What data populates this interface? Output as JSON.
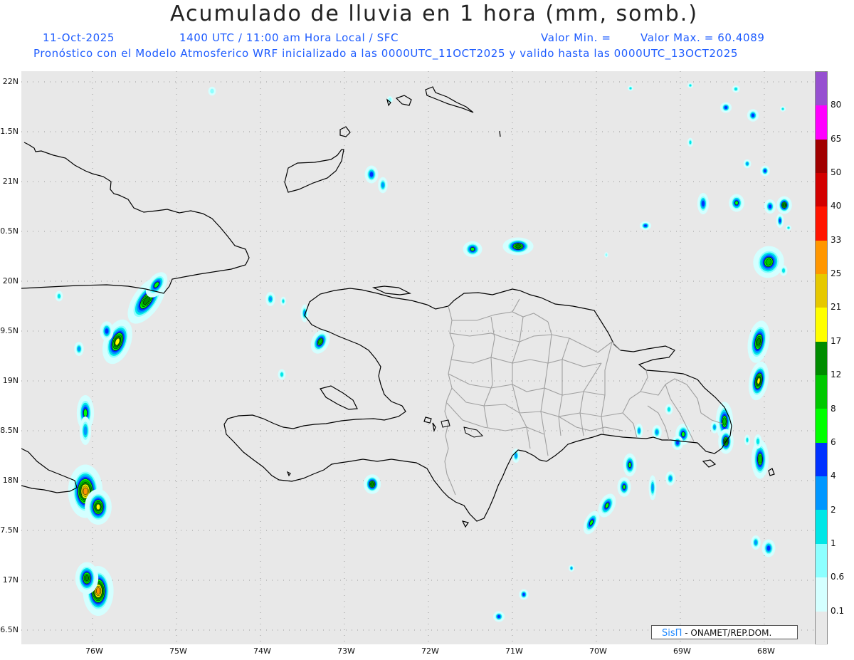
{
  "header": {
    "title": "Acumulado de lluvia en 1 hora (mm, somb.)",
    "date": "11-Oct-2025",
    "time_line": "1400 UTC / 11:00 am Hora Local / SFC",
    "valor_min": "Valor Min. =",
    "valor_max": "Valor Max. = 60.4089",
    "description": "Pronóstico con el Modelo Atmosferico WRF inicializado a las 0000UTC_11OCT2025 y valido hasta las  0000UTC_13OCT2025"
  },
  "axes": {
    "lat_labels": [
      "22N",
      "1.5N",
      "21N",
      "0.5N",
      "20N",
      "9.5N",
      "19N",
      "8.5N",
      "18N",
      "7.5N",
      "17N",
      "6.5N"
    ],
    "lon_labels": [
      "76W",
      "75W",
      "74W",
      "73W",
      "72W",
      "71W",
      "70W",
      "69W",
      "68W"
    ]
  },
  "colorbar": {
    "labels": [
      "0.1",
      "0.6",
      "1",
      "2",
      "4",
      "6",
      "8",
      "12",
      "17",
      "21",
      "25",
      "33",
      "40",
      "50",
      "65",
      "80"
    ],
    "colors": [
      "#e8e8e8",
      "#d4ffff",
      "#8cffff",
      "#00e6e6",
      "#0096ff",
      "#0032ff",
      "#00ff00",
      "#00c800",
      "#008c00",
      "#ffff00",
      "#e6c800",
      "#ff9600",
      "#ff1400",
      "#d20000",
      "#a00000",
      "#ff00ff",
      "#9650d0"
    ]
  },
  "credit": {
    "logo": "SisΠ",
    "text": "- ONAMET/REP.DOM."
  },
  "map": {
    "background": "#e8e8e8",
    "coast_color": "#000000",
    "border_color": "#a0a0a0"
  }
}
